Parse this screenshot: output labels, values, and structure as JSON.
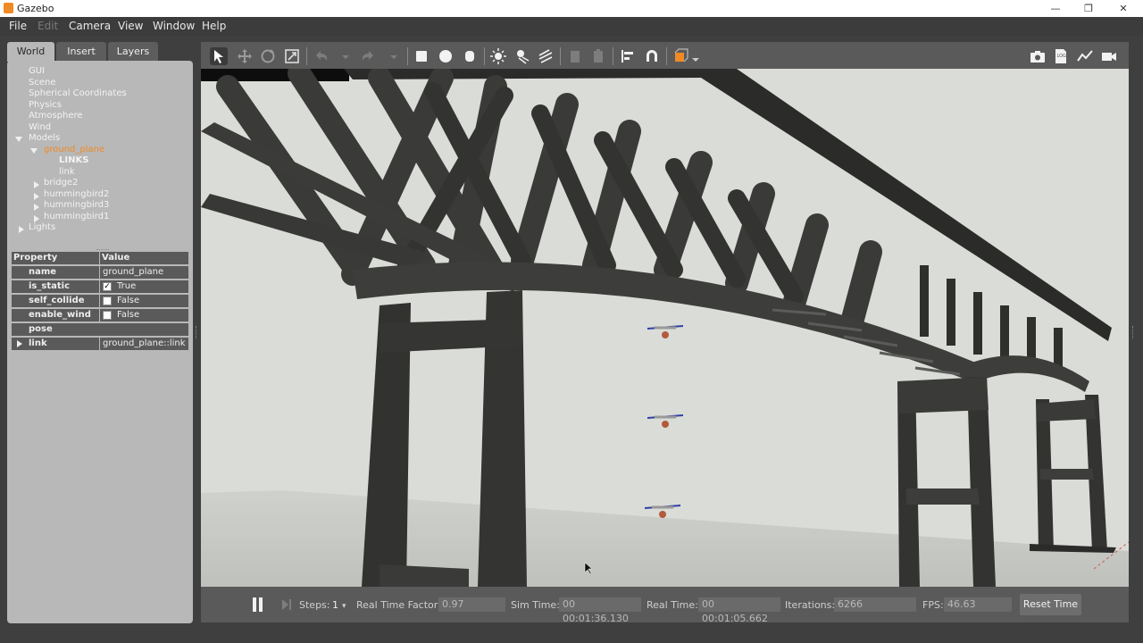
{
  "window": {
    "title": "Gazebo",
    "min_icon": "minimize-icon",
    "max_icon": "restore-icon",
    "close_icon": "close-icon",
    "min": "—",
    "max": "❐",
    "close": "✕"
  },
  "menu": [
    "File",
    "Edit",
    "Camera",
    "View",
    "Window",
    "Help"
  ],
  "tabs": [
    "World",
    "Insert",
    "Layers"
  ],
  "tree": {
    "gui": "GUI",
    "scene": "Scene",
    "spherical": "Spherical Coordinates",
    "physics": "Physics",
    "atmosphere": "Atmosphere",
    "wind": "Wind",
    "models": "Models",
    "ground_plane": "ground_plane",
    "links": "LINKS",
    "link": "link",
    "bridge2": "bridge2",
    "hb2": "hummingbird2",
    "hb3": "hummingbird3",
    "hb1": "hummingbird1",
    "lights": "Lights"
  },
  "properties": {
    "header": {
      "property": "Property",
      "value": "Value"
    },
    "rows": [
      {
        "key": "name",
        "value": "ground_plane"
      },
      {
        "key": "is_static",
        "value": "True",
        "checked": true
      },
      {
        "key": "self_collide",
        "value": "False",
        "checked": false
      },
      {
        "key": "enable_wind",
        "value": "False",
        "checked": false
      },
      {
        "key": "pose",
        "value": ""
      },
      {
        "key": "link",
        "value": "ground_plane::link"
      }
    ]
  },
  "toolbar_icons": [
    "select-icon",
    "translate-icon",
    "rotate-icon",
    "scale-icon",
    "undo-icon",
    "redo-icon",
    "box-icon",
    "sphere-icon",
    "cylinder-icon",
    "point-light-icon",
    "spot-light-icon",
    "directional-light-icon",
    "copy-icon",
    "paste-icon",
    "align-icon",
    "snap-icon",
    "view-angle-icon",
    "screenshot-icon",
    "log-icon",
    "plot-icon",
    "record-icon"
  ],
  "bottom": {
    "steps_label": "Steps:",
    "steps_value": "1",
    "rtf_label": "Real Time Factor:",
    "rtf_value": "0.97",
    "sim_label": "Sim Time:",
    "sim_value": "00 00:01:36.130",
    "real_label": "Real Time:",
    "real_value": "00 00:01:05.662",
    "iter_label": "Iterations:",
    "iter_value": "6266",
    "fps_label": "FPS:",
    "fps_value": "46.63",
    "reset_label": "Reset Time"
  },
  "colors": {
    "accent": "#f08a24",
    "panel": "#b8b8b8",
    "dark": "#3c3c3c",
    "bridge": "#353633",
    "sky": "#d9dcd7"
  }
}
